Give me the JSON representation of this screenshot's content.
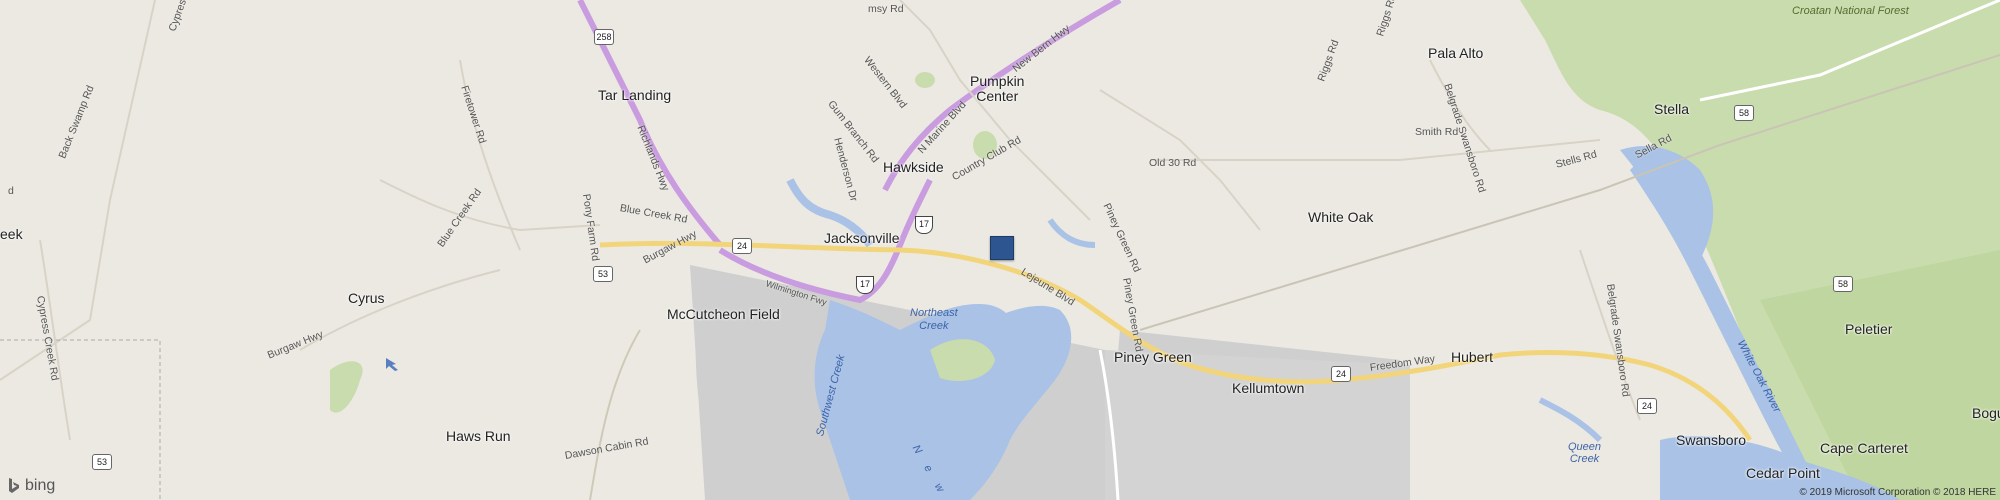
{
  "map": {
    "places": {
      "tar_landing": "Tar Landing",
      "pumpkin_center": "Pumpkin\nCenter",
      "hawkside": "Hawkside",
      "jacksonville": "Jacksonville",
      "mccutcheon_field": "McCutcheon Field",
      "cyrus": "Cyrus",
      "haws_run": "Haws Run",
      "white_oak": "White Oak",
      "pala_alto": "Pala Alto",
      "stella": "Stella",
      "piney_green": "Piney Green",
      "kellumtown": "Kellumtown",
      "hubert": "Hubert",
      "swansboro": "Swansboro",
      "peletier": "Peletier",
      "cape_carteret": "Cape Carteret",
      "cedar_point": "Cedar Point",
      "bogue": "Bogu",
      "leek": "eek"
    },
    "roads": {
      "cypress": "Cypres",
      "rd_top_left": "msy Rd",
      "back_swamp": "Back Swamp Rd",
      "firetower": "Firetower Rd",
      "richlands": "Richlands Hwy",
      "western": "Western Blvd",
      "gum_branch": "Gum Branch Rd",
      "henderson": "Henderson Dr",
      "n_marine": "N Marine Blvd",
      "new_bern": "New Bern Hwy",
      "country_club": "Country Club Rd",
      "old_30": "Old 30 Rd",
      "piney_green_rd": "Piney Green Rd",
      "piney_green_rd2": "Piney Green Rd",
      "blue_creek_rd": "Blue Creek Rd",
      "blue_creek_rd2": "Blue Creek Rd",
      "pony_farm": "Pony Farm Rd",
      "burgaw_hwy": "Burgaw Hwy",
      "burgaw_hwy2": "Burgaw Hwy",
      "cypress_creek": "Cypress Creek Rd",
      "rd_left": "d",
      "dawson_cabin": "Dawson Cabin Rd",
      "freeway": "Wilmington Fwy",
      "lejeune": "Lejeune Blvd",
      "riggs": "Riggs Rd",
      "belgrade_swansboro": "Belgrade Swansboro Rd",
      "belgrade_swansboro2": "Belgrade Swansboro Rd",
      "smith": "Smith Rd",
      "stells": "Stells Rd",
      "sella": "Sella Rd",
      "freedom_way": "Freedom Way",
      "riggs_top": "Riggs Rd"
    },
    "water": {
      "northeast_creek": "Northeast\nCreek",
      "southwest_creek": "Southwest Creek",
      "new_river": "N e w",
      "white_oak_river": "White Oak River",
      "queen_creek": "Queen\nCreek"
    },
    "forest": "Croatan National Forest",
    "shields": {
      "s258": "258",
      "s24a": "24",
      "s53a": "53",
      "s17a": "17",
      "s17b": "17",
      "s24b": "24",
      "s24c": "24",
      "s58a": "58",
      "s58b": "58",
      "s53b": "53"
    },
    "pin_label": "Selected location"
  },
  "branding": {
    "logo_text": "bing",
    "copyright": "© 2019 Microsoft Corporation © 2018 HERE"
  }
}
